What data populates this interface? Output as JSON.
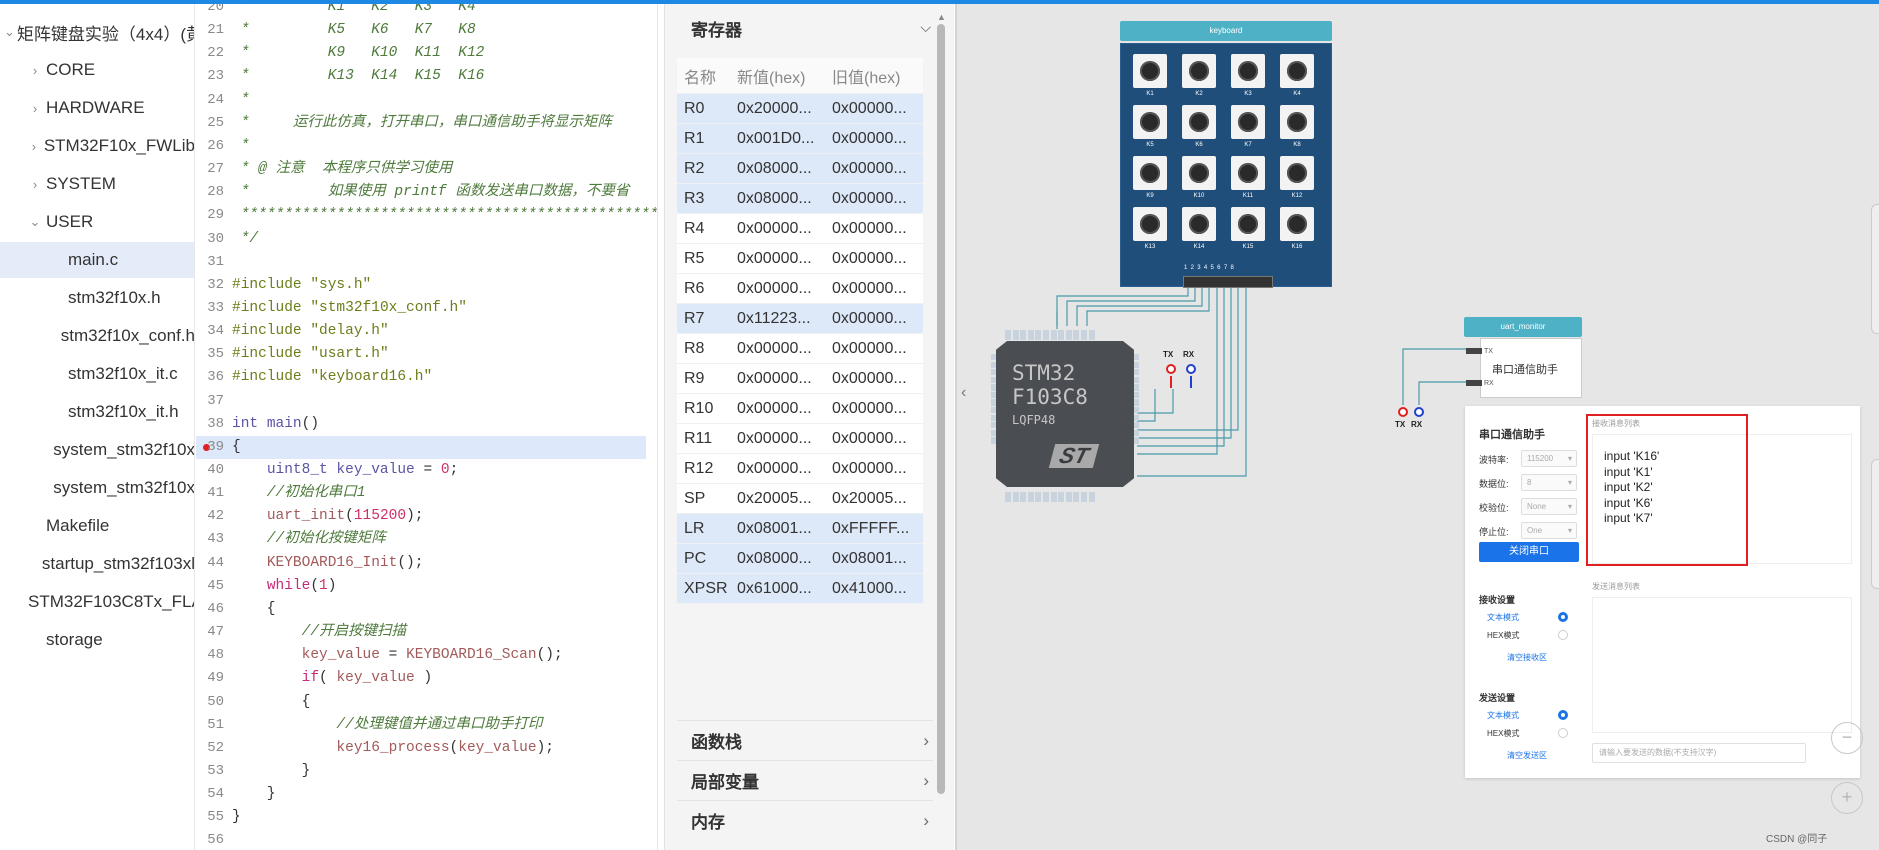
{
  "file_tree": {
    "items": [
      {
        "label": "矩阵键盘实验（4x4）(黄",
        "depth": 0,
        "chevron": "expanded"
      },
      {
        "label": "CORE",
        "depth": 1,
        "chevron": "collapsed"
      },
      {
        "label": "HARDWARE",
        "depth": 1,
        "chevron": "collapsed"
      },
      {
        "label": "STM32F10x_FWLib",
        "depth": 1,
        "chevron": "collapsed"
      },
      {
        "label": "SYSTEM",
        "depth": 1,
        "chevron": "collapsed"
      },
      {
        "label": "USER",
        "depth": 1,
        "chevron": "expanded"
      },
      {
        "label": "main.c",
        "depth": 2,
        "chevron": "",
        "selected": true
      },
      {
        "label": "stm32f10x.h",
        "depth": 2,
        "chevron": ""
      },
      {
        "label": "stm32f10x_conf.h",
        "depth": 2,
        "chevron": ""
      },
      {
        "label": "stm32f10x_it.c",
        "depth": 2,
        "chevron": ""
      },
      {
        "label": "stm32f10x_it.h",
        "depth": 2,
        "chevron": ""
      },
      {
        "label": "system_stm32f10x",
        "depth": 2,
        "chevron": ""
      },
      {
        "label": "system_stm32f10x",
        "depth": 2,
        "chevron": ""
      },
      {
        "label": "Makefile",
        "depth": 1,
        "chevron": ""
      },
      {
        "label": "startup_stm32f103xl",
        "depth": 1,
        "chevron": ""
      },
      {
        "label": "STM32F103C8Tx_FLA",
        "depth": 1,
        "chevron": ""
      },
      {
        "label": "storage",
        "depth": 1,
        "chevron": ""
      }
    ]
  },
  "editor": {
    "current_line": 39,
    "breakpoint_line": 39,
    "lines": [
      {
        "n": "20",
        "t": " *         K1   K2   K3   K4",
        "c": "cm"
      },
      {
        "n": "21",
        "t": " *         K5   K6   K7   K8",
        "c": "cm"
      },
      {
        "n": "22",
        "t": " *         K9   K10  K11  K12",
        "c": "cm"
      },
      {
        "n": "23",
        "t": " *         K13  K14  K15  K16",
        "c": "cm"
      },
      {
        "n": "24",
        "t": " *",
        "c": "cm"
      },
      {
        "n": "25",
        "t": " *     运行此仿真，打开串口，串口通信助手将显示矩阵",
        "c": "cm"
      },
      {
        "n": "26",
        "t": " *",
        "c": "cm"
      },
      {
        "n": "27",
        "t": " * @ 注意  本程序只供学习使用",
        "c": "cm"
      },
      {
        "n": "28",
        "t": " *         如果使用 printf 函数发送串口数据，不要省",
        "c": "cm"
      },
      {
        "n": "29",
        "t": " ****************************************************",
        "c": "cm"
      },
      {
        "n": "30",
        "t": " */",
        "c": "cm"
      },
      {
        "n": "31",
        "t": "",
        "c": ""
      },
      {
        "n": "32",
        "t": "#include \"sys.h\"",
        "c": "pp"
      },
      {
        "n": "33",
        "t": "#include \"stm32f10x_conf.h\"",
        "c": "pp"
      },
      {
        "n": "34",
        "t": "#include \"delay.h\"",
        "c": "pp"
      },
      {
        "n": "35",
        "t": "#include \"usart.h\"",
        "c": "pp"
      },
      {
        "n": "36",
        "t": "#include \"keyboard16.h\"",
        "c": "pp"
      },
      {
        "n": "37",
        "t": "",
        "c": ""
      },
      {
        "n": "38",
        "t": "int main()",
        "c": "fn"
      },
      {
        "n": "39",
        "t": "{",
        "c": ""
      },
      {
        "n": "40",
        "t": "    uint8_t key_value = 0;",
        "c": "decl"
      },
      {
        "n": "41",
        "t": "    //初始化串口1",
        "c": "cm"
      },
      {
        "n": "42",
        "t": "    uart_init(115200);",
        "c": "call_num"
      },
      {
        "n": "43",
        "t": "    //初始化按键矩阵",
        "c": "cm"
      },
      {
        "n": "44",
        "t": "    KEYBOARD16_Init();",
        "c": "call"
      },
      {
        "n": "45",
        "t": "    while(1)",
        "c": "kw_num"
      },
      {
        "n": "46",
        "t": "    {",
        "c": ""
      },
      {
        "n": "47",
        "t": "        //开启按键扫描",
        "c": "cm"
      },
      {
        "n": "48",
        "t": "        key_value = KEYBOARD16_Scan();",
        "c": "assign"
      },
      {
        "n": "49",
        "t": "        if( key_value )",
        "c": "kw_if"
      },
      {
        "n": "50",
        "t": "        {",
        "c": ""
      },
      {
        "n": "51",
        "t": "            //处理键值并通过串口助手打印",
        "c": "cm"
      },
      {
        "n": "52",
        "t": "            key16_process(key_value);",
        "c": "call2"
      },
      {
        "n": "53",
        "t": "        }",
        "c": ""
      },
      {
        "n": "54",
        "t": "    }",
        "c": ""
      },
      {
        "n": "55",
        "t": "}",
        "c": ""
      },
      {
        "n": "56",
        "t": "",
        "c": ""
      }
    ]
  },
  "registers": {
    "title": "寄存器",
    "headers": [
      "名称",
      "新值(hex)",
      "旧值(hex)"
    ],
    "rows": [
      {
        "name": "R0",
        "new": "0x20000...",
        "old": "0x00000...",
        "changed": true
      },
      {
        "name": "R1",
        "new": "0x001D0...",
        "old": "0x00000...",
        "changed": true
      },
      {
        "name": "R2",
        "new": "0x08000...",
        "old": "0x00000...",
        "changed": true
      },
      {
        "name": "R3",
        "new": "0x08000...",
        "old": "0x00000...",
        "changed": true
      },
      {
        "name": "R4",
        "new": "0x00000...",
        "old": "0x00000...",
        "changed": false
      },
      {
        "name": "R5",
        "new": "0x00000...",
        "old": "0x00000...",
        "changed": false
      },
      {
        "name": "R6",
        "new": "0x00000...",
        "old": "0x00000...",
        "changed": false
      },
      {
        "name": "R7",
        "new": "0x11223...",
        "old": "0x00000...",
        "changed": true
      },
      {
        "name": "R8",
        "new": "0x00000...",
        "old": "0x00000...",
        "changed": false
      },
      {
        "name": "R9",
        "new": "0x00000...",
        "old": "0x00000...",
        "changed": false
      },
      {
        "name": "R10",
        "new": "0x00000...",
        "old": "0x00000...",
        "changed": false
      },
      {
        "name": "R11",
        "new": "0x00000...",
        "old": "0x00000...",
        "changed": false
      },
      {
        "name": "R12",
        "new": "0x00000...",
        "old": "0x00000...",
        "changed": false
      },
      {
        "name": "SP",
        "new": "0x20005...",
        "old": "0x20005...",
        "changed": false
      },
      {
        "name": "LR",
        "new": "0x08001...",
        "old": "0xFFFFF...",
        "changed": true
      },
      {
        "name": "PC",
        "new": "0x08000...",
        "old": "0x08001...",
        "changed": true
      },
      {
        "name": "XPSR",
        "new": "0x61000...",
        "old": "0x41000...",
        "changed": true
      }
    ],
    "sections": [
      "函数栈",
      "局部变量",
      "内存"
    ]
  },
  "keyboard": {
    "title": "keyboard",
    "keys": [
      "K1",
      "K2",
      "K3",
      "K4",
      "K5",
      "K6",
      "K7",
      "K8",
      "K9",
      "K10",
      "K11",
      "K12",
      "K13",
      "K14",
      "K15",
      "K16"
    ],
    "pin_numbers": "12345678"
  },
  "chip": {
    "line1": "STM32",
    "line2": "F103C8",
    "line3": "LQFP48",
    "logo": "ST",
    "probe_tx": "TX",
    "probe_rx": "RX"
  },
  "uart_monitor": {
    "title": "uart_monitor",
    "label": "串口通信助手",
    "pin_tx": "TX",
    "pin_rx": "RX",
    "probe_tx": "TX",
    "probe_rx": "RX"
  },
  "uart_panel": {
    "title": "串口通信助手",
    "baud_label": "波特率:",
    "baud_value": "115200",
    "data_bits_label": "数据位:",
    "data_bits_value": "8",
    "parity_label": "校验位:",
    "parity_value": "None",
    "stop_bits_label": "停止位:",
    "stop_bits_value": "One",
    "close_button": "关闭串口",
    "recv_settings": "接收设置",
    "recv_text_mode": "文本模式",
    "recv_hex_mode": "HEX模式",
    "recv_mode_selected": "text",
    "clear_recv": "清空接收区",
    "send_settings": "发送设置",
    "send_text_mode": "文本模式",
    "send_hex_mode": "HEX模式",
    "send_mode_selected": "text",
    "clear_send": "清空发送区",
    "recv_list_label": "接收消息列表",
    "recv_messages": [
      "input 'K16'",
      "input 'K1'",
      "input 'K2'",
      "input 'K6'",
      "input 'K7'"
    ],
    "send_list_label": "发送消息列表",
    "send_placeholder": "请输入要发送的数据(不支持汉字)"
  },
  "canvas": {
    "zoom_out": "−",
    "zoom_in": "+",
    "collapse_chevron": "‹",
    "watermark": "CSDN @同子"
  },
  "colors": {
    "accent": "#1a73e8",
    "keyboard_body": "#1f4e7a",
    "module_header": "#4fb1c6",
    "wire": "#4a9aa8",
    "highlight_box": "#e02020",
    "register_changed": "#dde8f9"
  }
}
